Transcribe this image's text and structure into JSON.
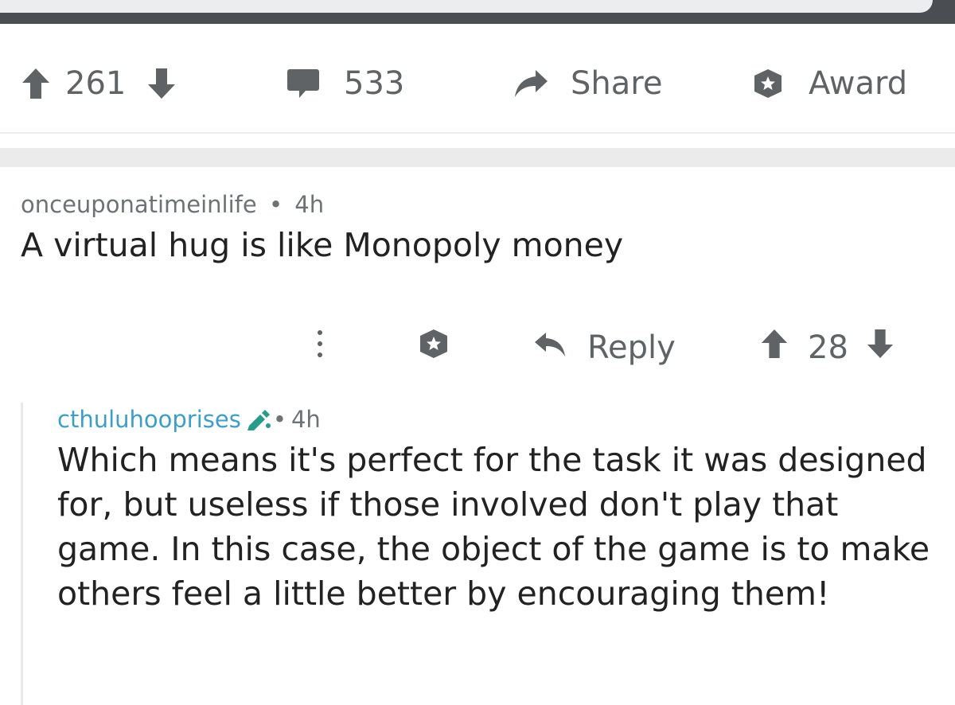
{
  "post_actions": {
    "upvotes": "261",
    "comments": "533",
    "share_label": "Share",
    "award_label": "Award"
  },
  "comment": {
    "author": "onceuponatimeinlife",
    "separator": "•",
    "age": "4h",
    "body": "A virtual hug is like Monopoly money",
    "reply_label": "Reply",
    "score": "28"
  },
  "reply": {
    "author": "cthuluhooprises",
    "separator": "•",
    "age": "4h",
    "body": "Which means it's perfect for the task it was designed for, but useless if those involved don't play that game. In this case, the object of the game is to make others feel a little better by encouraging them!"
  },
  "icons": {
    "upvote": "arrow-up-icon",
    "downvote": "arrow-down-icon",
    "comments": "comment-bubble-icon",
    "share": "share-arrow-icon",
    "award": "award-star-icon",
    "more": "more-vertical-icon",
    "reply": "reply-arrow-icon",
    "flair": "pencil-icon"
  },
  "colors": {
    "icon_gray": "#5f6366",
    "meta_gray": "#6e7276",
    "reply_username": "#3d9fc9",
    "flair": "#2a9a8a"
  }
}
